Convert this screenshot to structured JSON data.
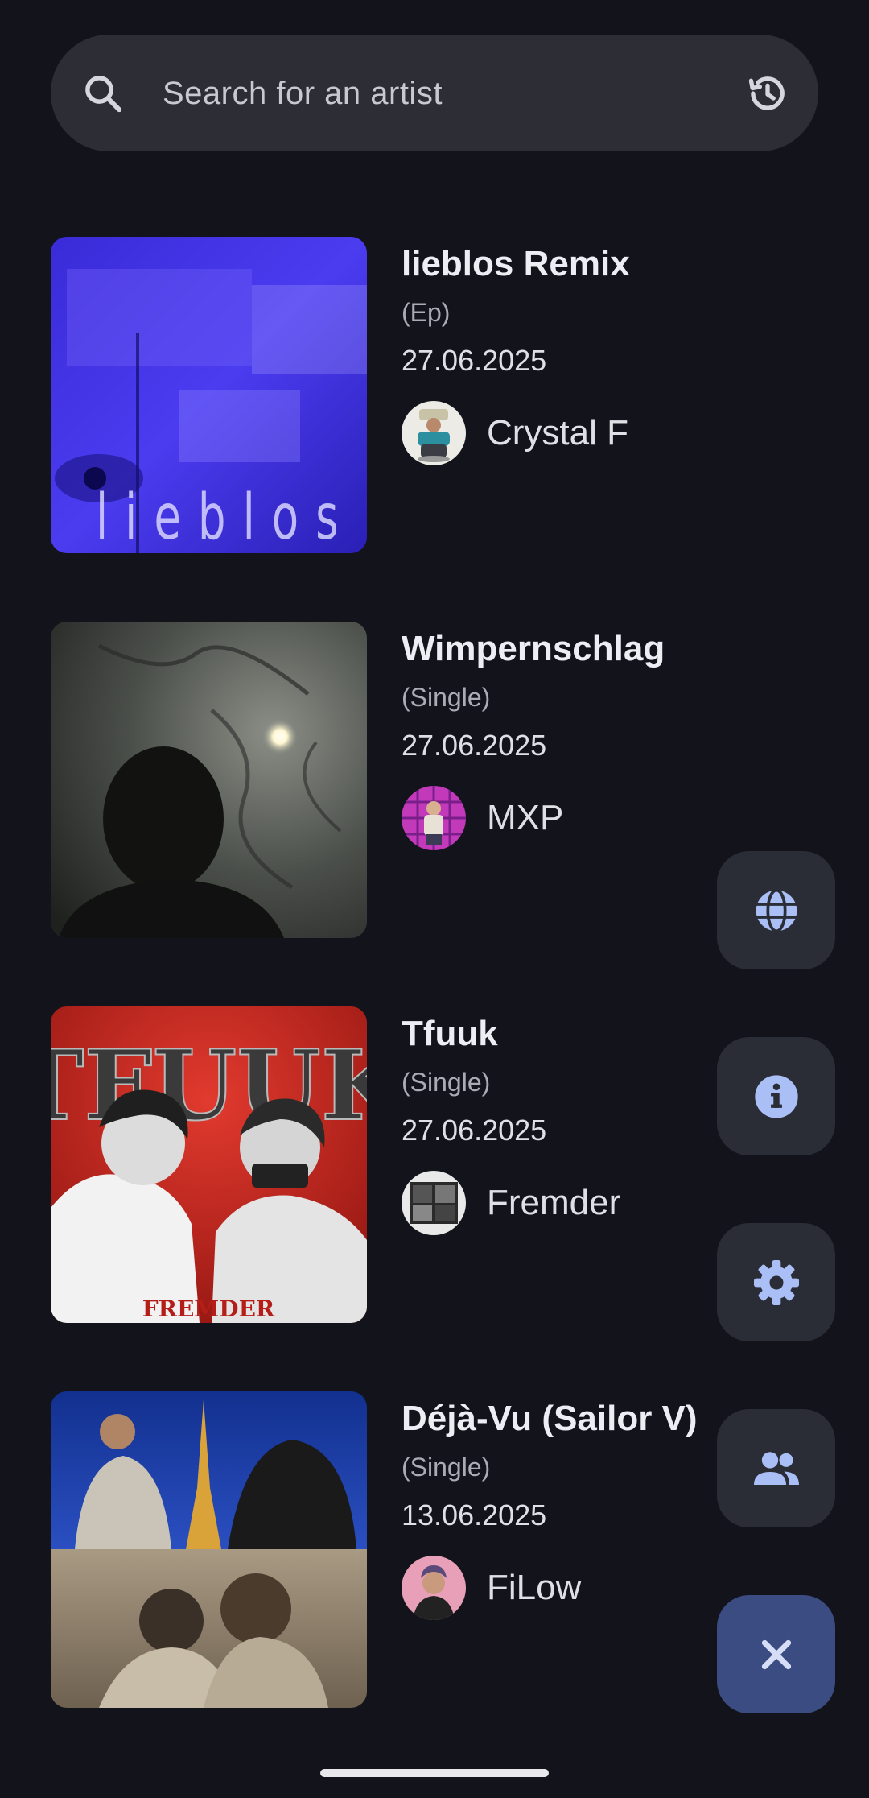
{
  "search": {
    "placeholder": "Search for an artist",
    "leading_icon": "search-icon",
    "trailing_icon": "history-icon"
  },
  "releases": [
    {
      "title": "lieblos Remix",
      "type": "(Ep)",
      "date": "27.06.2025",
      "artist": "Crystal F",
      "cover_text": "lieblos"
    },
    {
      "title": "Wimpernschlag",
      "type": "(Single)",
      "date": "27.06.2025",
      "artist": "MXP"
    },
    {
      "title": "Tfuuk",
      "type": "(Single)",
      "date": "27.06.2025",
      "artist": "Fremder",
      "cover_text": "TFUUK",
      "cover_sub": "FREMDER"
    },
    {
      "title": "Déjà-Vu (Sailor V)",
      "type": "(Single)",
      "date": "13.06.2025",
      "artist": "FiLow"
    }
  ],
  "fabs": [
    {
      "icon": "globe-icon"
    },
    {
      "icon": "info-icon"
    },
    {
      "icon": "gear-icon"
    },
    {
      "icon": "people-icon"
    },
    {
      "icon": "close-icon"
    }
  ],
  "colors": {
    "background": "#13141b",
    "surface": "#2c2d35",
    "fab_icon": "#a9bff5",
    "close_fab": "#3b4c82"
  }
}
